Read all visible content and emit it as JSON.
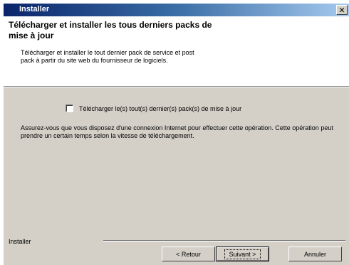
{
  "window": {
    "title": "Installer",
    "close_label": "✕"
  },
  "header": {
    "title": "Télécharger et installer les tous derniers packs de mise à jour",
    "description": "Télécharger et installer le tout dernier pack de service et post pack à partir du site web du fournisseur de logiciels."
  },
  "content": {
    "checkbox_label": "Télécharger le(s) tout(s) dernier(s) pack(s) de mise à jour",
    "checkbox_checked": false,
    "info_text": "Assurez-vous que vous disposez d'une connexion Internet pour effectuer cette opération. Cette opération peut prendre un certain temps selon la vitesse de téléchargement."
  },
  "footer": {
    "brand_label": "Installer",
    "back_label": "< Retour",
    "next_label": "Suivant >",
    "cancel_label": "Annuler"
  }
}
